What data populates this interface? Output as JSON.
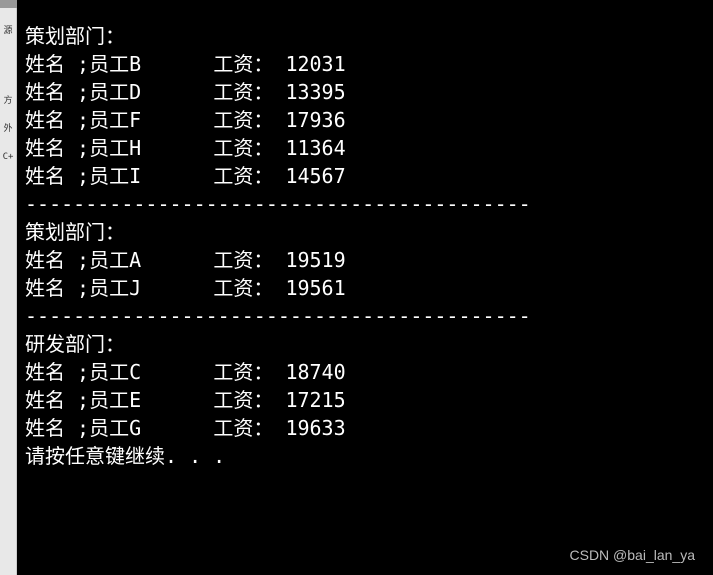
{
  "labels": {
    "name_prefix": "姓名 ;",
    "salary_prefix": "工资：",
    "prompt": "请按任意键继续. . .",
    "separator": "------------------------------------------"
  },
  "sections": [
    {
      "header": "策划部门：",
      "employees": [
        {
          "name": "员工B",
          "salary": "12031"
        },
        {
          "name": "员工D",
          "salary": "13395"
        },
        {
          "name": "员工F",
          "salary": "17936"
        },
        {
          "name": "员工H",
          "salary": "11364"
        },
        {
          "name": "员工I",
          "salary": "14567"
        }
      ]
    },
    {
      "header": "策划部门：",
      "employees": [
        {
          "name": "员工A",
          "salary": "19519"
        },
        {
          "name": "员工J",
          "salary": "19561"
        }
      ]
    },
    {
      "header": "研发部门：",
      "employees": [
        {
          "name": "员工C",
          "salary": "18740"
        },
        {
          "name": "员工E",
          "salary": "17215"
        },
        {
          "name": "员工G",
          "salary": "19633"
        }
      ]
    }
  ],
  "watermark": "CSDN @bai_lan_ya",
  "sidebar_fragments": [
    "源",
    "方",
    "外",
    "C+"
  ]
}
